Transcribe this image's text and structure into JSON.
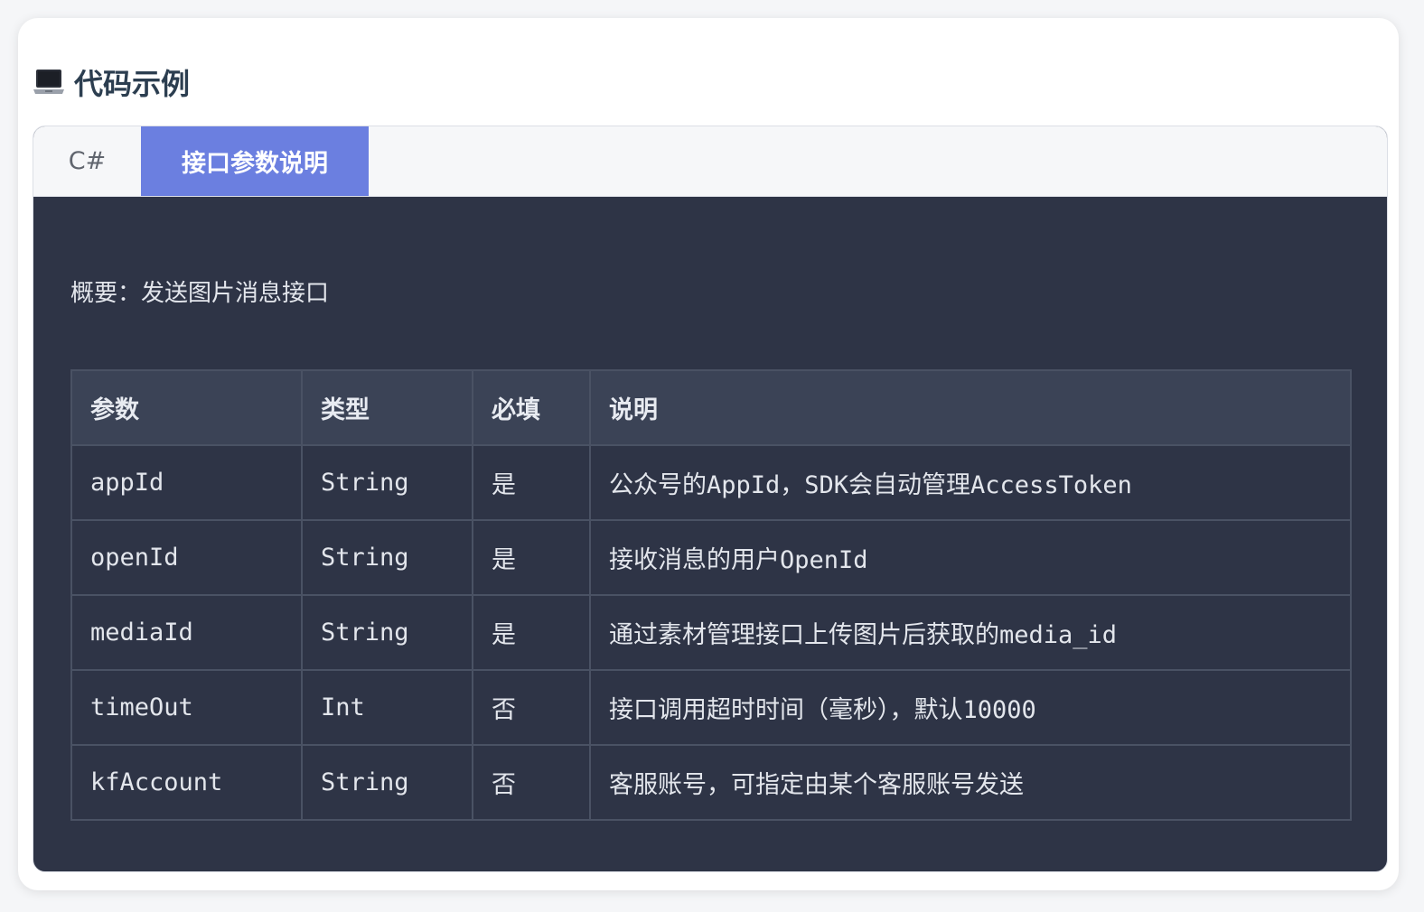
{
  "section": {
    "title": "代码示例",
    "icon": "laptop-icon"
  },
  "tabs": [
    {
      "label": "C#",
      "active": false
    },
    {
      "label": "接口参数说明",
      "active": true
    }
  ],
  "colors": {
    "accent": "#6b7fe0",
    "panel_bg": "#2e3446",
    "header_bg": "#3b4356"
  },
  "content": {
    "summary": "概要：发送图片消息接口",
    "table": {
      "headers": [
        "参数",
        "类型",
        "必填",
        "说明"
      ],
      "rows": [
        [
          "appId",
          "String",
          "是",
          "公众号的AppId，SDK会自动管理AccessToken"
        ],
        [
          "openId",
          "String",
          "是",
          "接收消息的用户OpenId"
        ],
        [
          "mediaId",
          "String",
          "是",
          "通过素材管理接口上传图片后获取的media_id"
        ],
        [
          "timeOut",
          "Int",
          "否",
          "接口调用超时时间（毫秒），默认10000"
        ],
        [
          "kfAccount",
          "String",
          "否",
          "客服账号，可指定由某个客服账号发送"
        ]
      ]
    }
  }
}
